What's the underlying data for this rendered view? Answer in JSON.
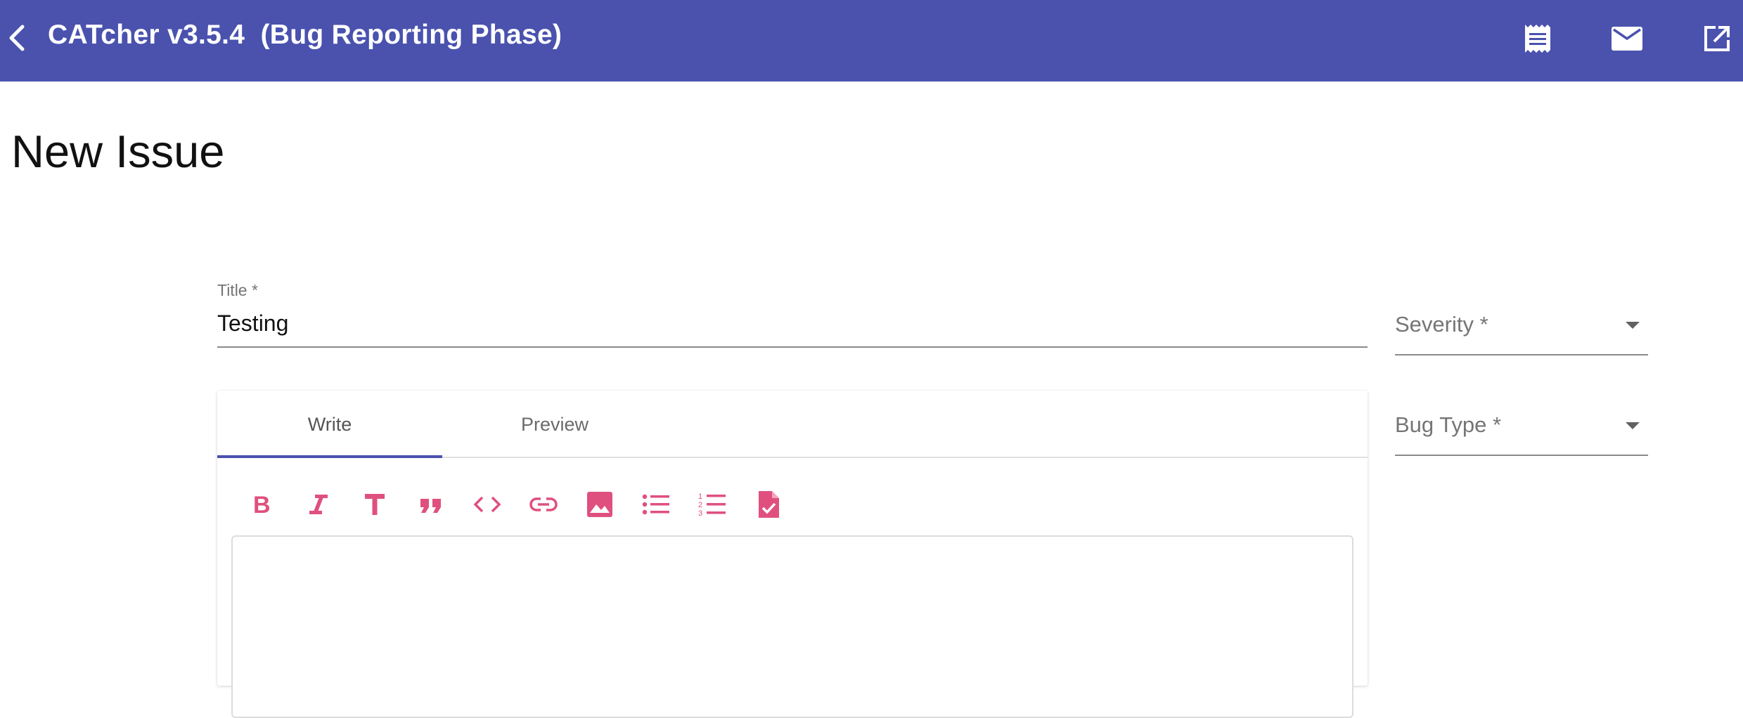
{
  "toolbar": {
    "title": "CATcher v3.5.4  (Bug Reporting Phase)",
    "back_icon": "chevron-left-icon",
    "actions": [
      {
        "name": "receipt-icon"
      },
      {
        "name": "mail-icon"
      },
      {
        "name": "open-in-new-icon"
      }
    ],
    "color": "#4a52ae"
  },
  "page": {
    "title": "New Issue"
  },
  "form": {
    "title_label": "Title *",
    "title_value": "Testing",
    "severity_label": "Severity *",
    "bug_type_label": "Bug Type *",
    "tabs": [
      "Write",
      "Preview"
    ],
    "active_tab": "Write",
    "markdown_tools": [
      "bold-icon",
      "italic-icon",
      "heading-icon",
      "quote-icon",
      "code-icon",
      "link-icon",
      "image-icon",
      "bulleted-list-icon",
      "numbered-list-icon",
      "task-list-icon"
    ],
    "accent_color": "#e0507e"
  }
}
